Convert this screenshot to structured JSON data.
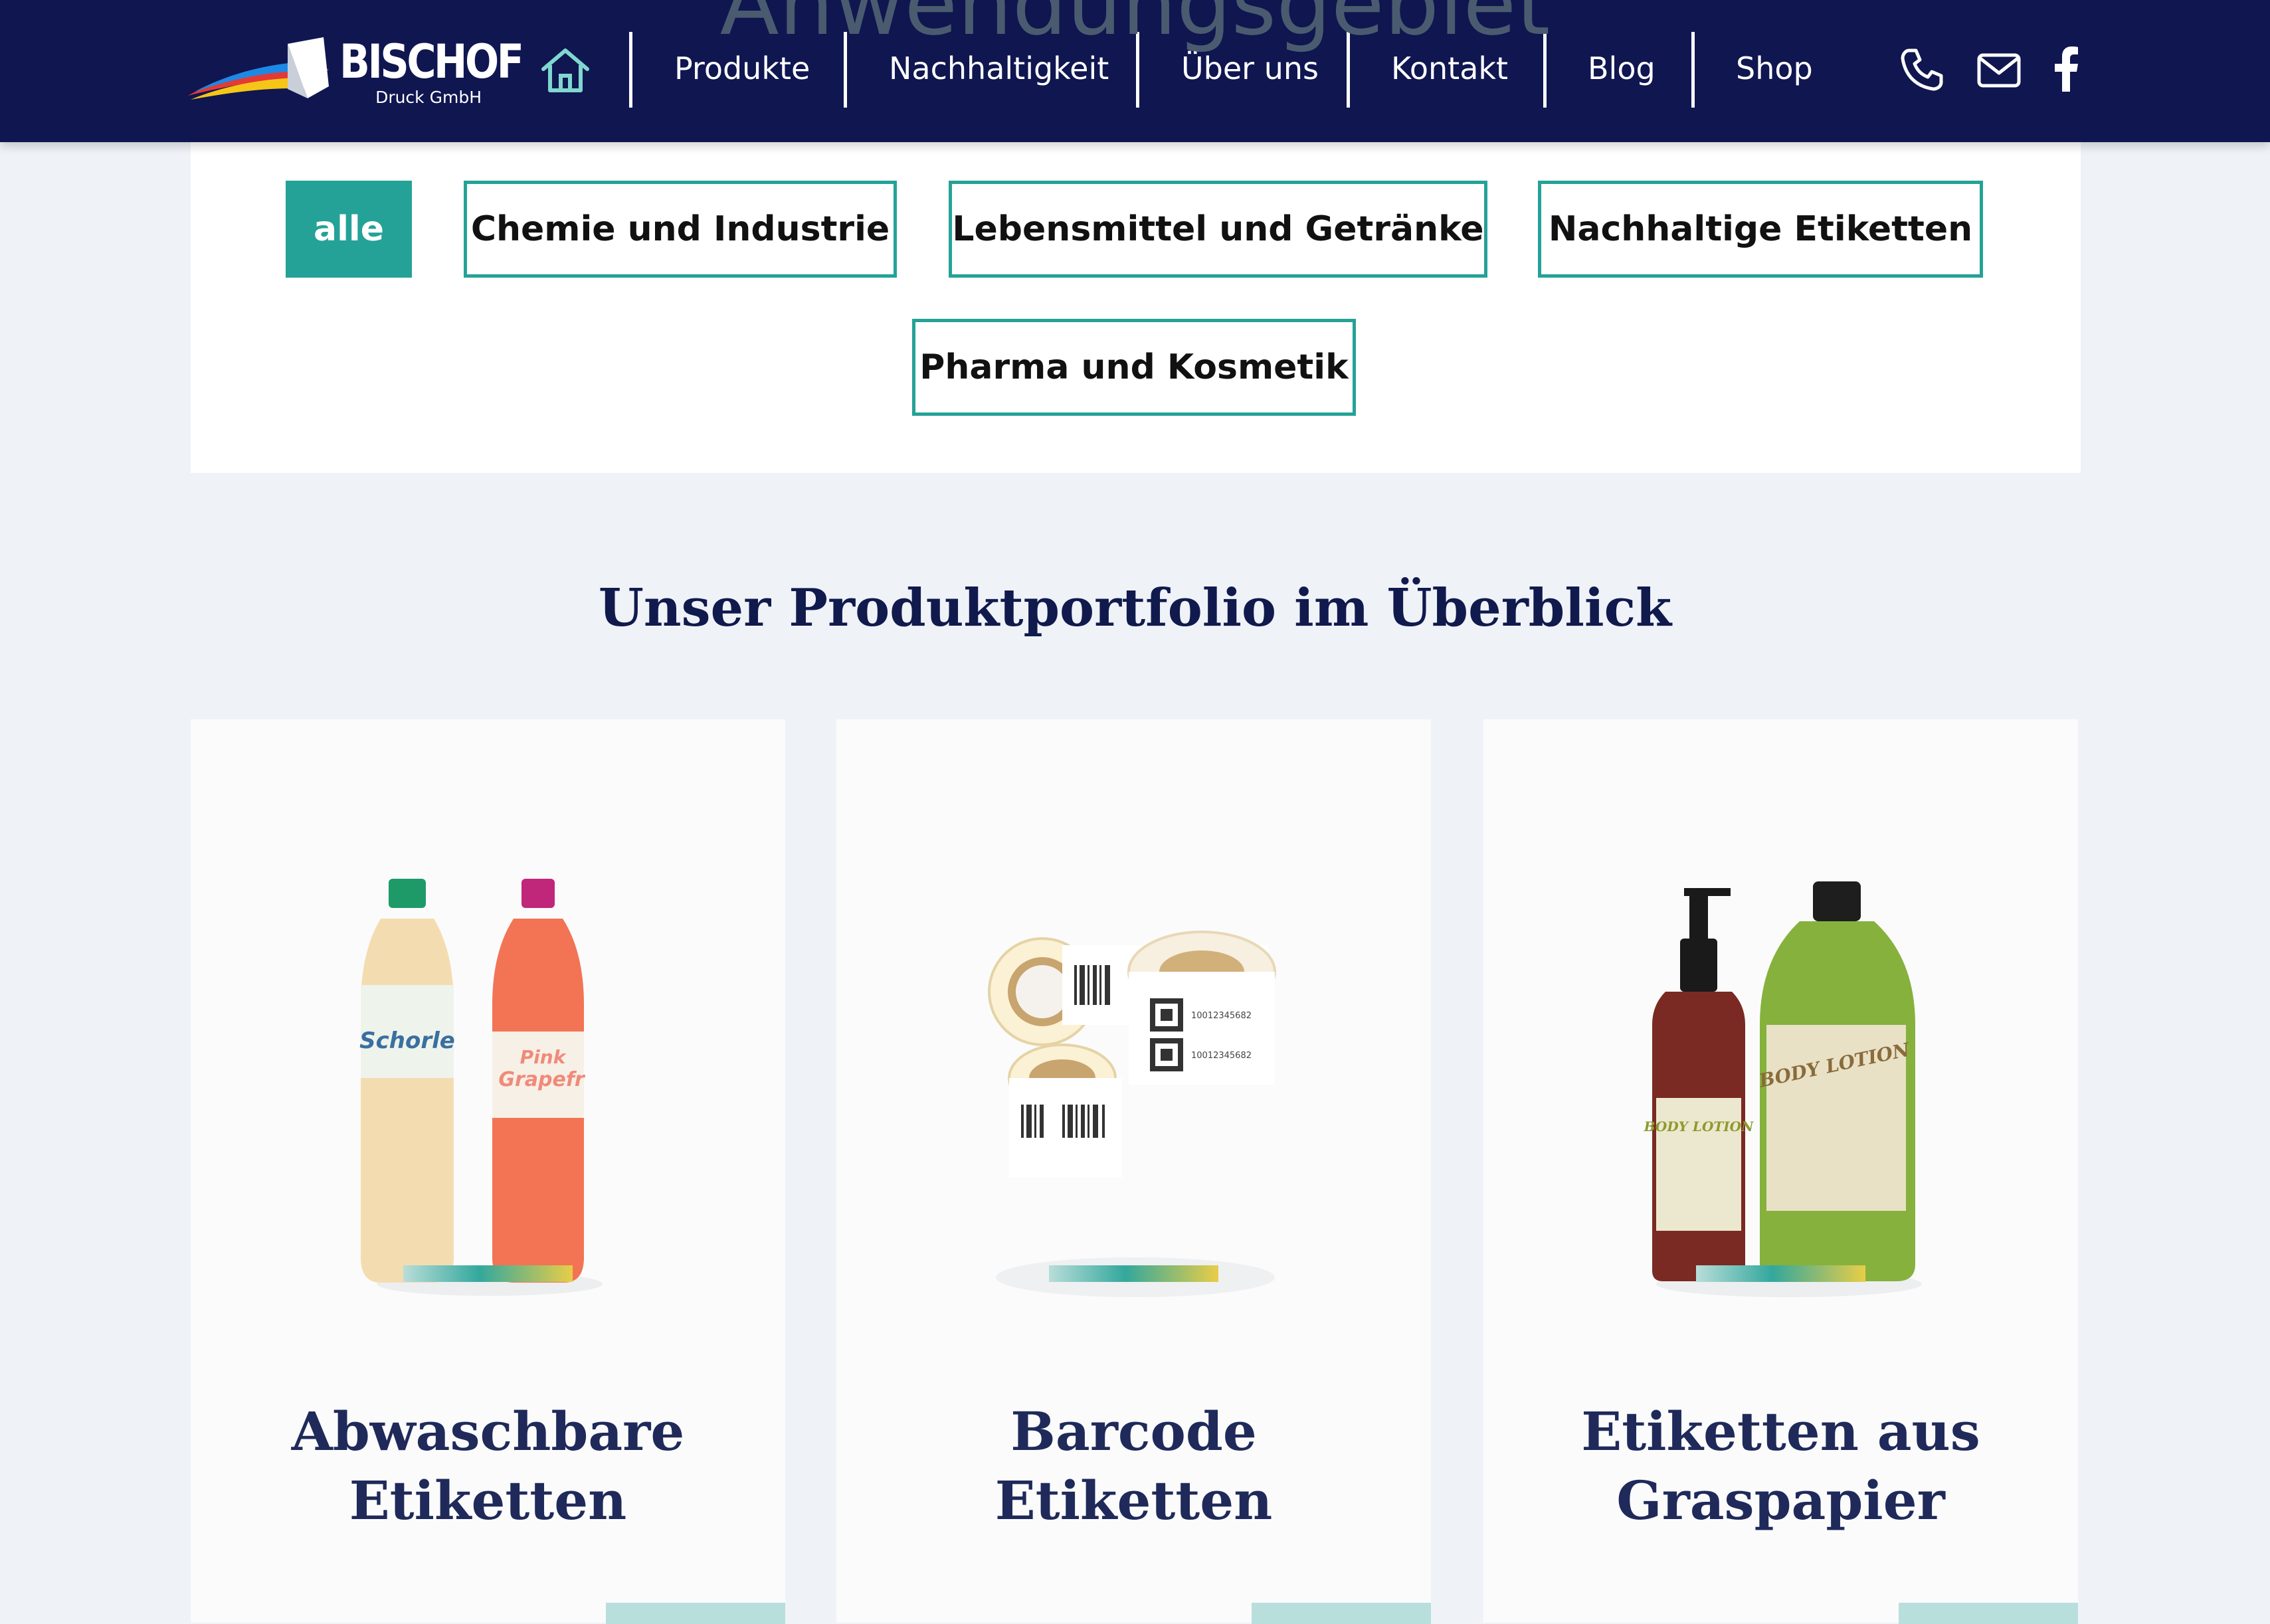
{
  "background_heading": "Anwendungsgebiet",
  "header": {
    "logo": {
      "name": "BISCHOF",
      "subtitle": "Druck GmbH"
    },
    "nav": [
      {
        "label": "Produkte"
      },
      {
        "label": "Nachhaltigkeit"
      },
      {
        "label": "Über uns"
      },
      {
        "label": "Kontakt"
      },
      {
        "label": "Blog"
      },
      {
        "label": "Shop"
      }
    ],
    "icons": [
      "home-icon",
      "phone-icon",
      "mail-icon",
      "facebook-icon"
    ]
  },
  "filters": {
    "chips": [
      {
        "label": "alle",
        "active": true
      },
      {
        "label": "Chemie und Industrie",
        "active": false
      },
      {
        "label": "Lebensmittel und Getränke",
        "active": false
      },
      {
        "label": "Nachhaltige Etiketten",
        "active": false
      },
      {
        "label": "Pharma und Kosmetik",
        "active": false
      }
    ]
  },
  "section": {
    "title": "Unser Produktportfolio im Überblick"
  },
  "cards": [
    {
      "title_line1": "Abwaschbare",
      "title_line2": "Etiketten",
      "image_text": {
        "label_a": "Schorle",
        "label_b": "Pink",
        "label_c": "Grapefr"
      }
    },
    {
      "title_line1": "Barcode",
      "title_line2": "Etiketten",
      "image_text": {
        "code_a": "10012345682",
        "code_b": "10012345682"
      }
    },
    {
      "title_line1": "Etiketten aus",
      "title_line2": "Graspapier",
      "image_text": {
        "label_a": "BODY LOTION",
        "label_b": "BODY LOTION"
      }
    }
  ],
  "colors": {
    "navbar": "#0f1650",
    "accent": "#24a297",
    "title": "#111a4d",
    "page_bg": "#eff3f8"
  }
}
